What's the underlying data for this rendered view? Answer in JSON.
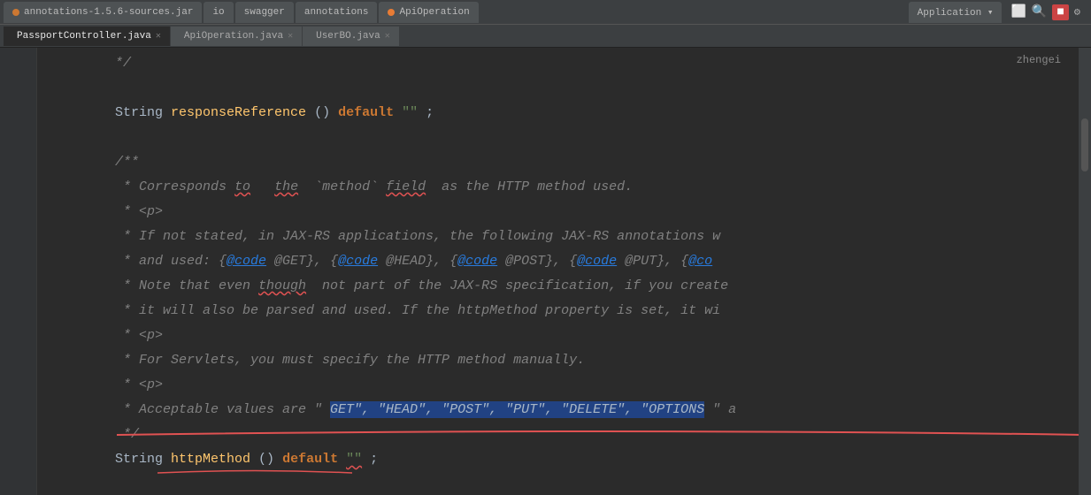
{
  "tabs": {
    "browser_tabs": [
      {
        "label": "annotations-1.5.6-sources.jar",
        "active": false,
        "icon": "jar"
      },
      {
        "label": "io",
        "active": false,
        "icon": "plain"
      },
      {
        "label": "swagger",
        "active": false,
        "icon": "plain"
      },
      {
        "label": "annotations",
        "active": false,
        "icon": "plain"
      },
      {
        "label": "ApiOperation",
        "active": false,
        "icon": "orange"
      },
      {
        "label": "Application",
        "active": false,
        "icon": "plain"
      }
    ],
    "file_tabs": [
      {
        "label": "PassportController.java",
        "active": true
      },
      {
        "label": "ApiOperation.java",
        "active": false
      },
      {
        "label": "UserBO.java",
        "active": false
      }
    ]
  },
  "username": "zhengei",
  "code": {
    "lines": [
      {
        "num": "",
        "content": "*/",
        "type": "comment_end"
      },
      {
        "num": "",
        "content": ""
      },
      {
        "num": "",
        "content": "String responseReference() default \"\";"
      },
      {
        "num": "",
        "content": ""
      },
      {
        "num": "",
        "content": "/**"
      },
      {
        "num": "",
        "content": " * Corresponds to the `method` field as the HTTP method used."
      },
      {
        "num": "",
        "content": " * <p>"
      },
      {
        "num": "",
        "content": " * If not stated, in JAX-RS applications, the following JAX-RS annotations w"
      },
      {
        "num": "",
        "content": " * and used: {@code @GET}, {@code @HEAD}, {@code @POST}, {@code @PUT}, {@co"
      },
      {
        "num": "",
        "content": " * Note that even though not part of the JAX-RS specification, if you create"
      },
      {
        "num": "",
        "content": " * it will also be parsed and used. If the httpMethod property is set, it wi"
      },
      {
        "num": "",
        "content": " * <p>"
      },
      {
        "num": "",
        "content": " * For Servlets, you must specify the HTTP method manually."
      },
      {
        "num": "",
        "content": " * <p>"
      },
      {
        "num": "",
        "content": " * Acceptable values are \"GET\", \"HEAD\", \"POST\", \"PUT\", \"DELETE\", \"OPTIONS\" a"
      },
      {
        "num": "",
        "content": " */"
      },
      {
        "num": "",
        "content": "String httpMethod() default \"\";"
      },
      {
        "num": "",
        "content": ""
      }
    ]
  }
}
